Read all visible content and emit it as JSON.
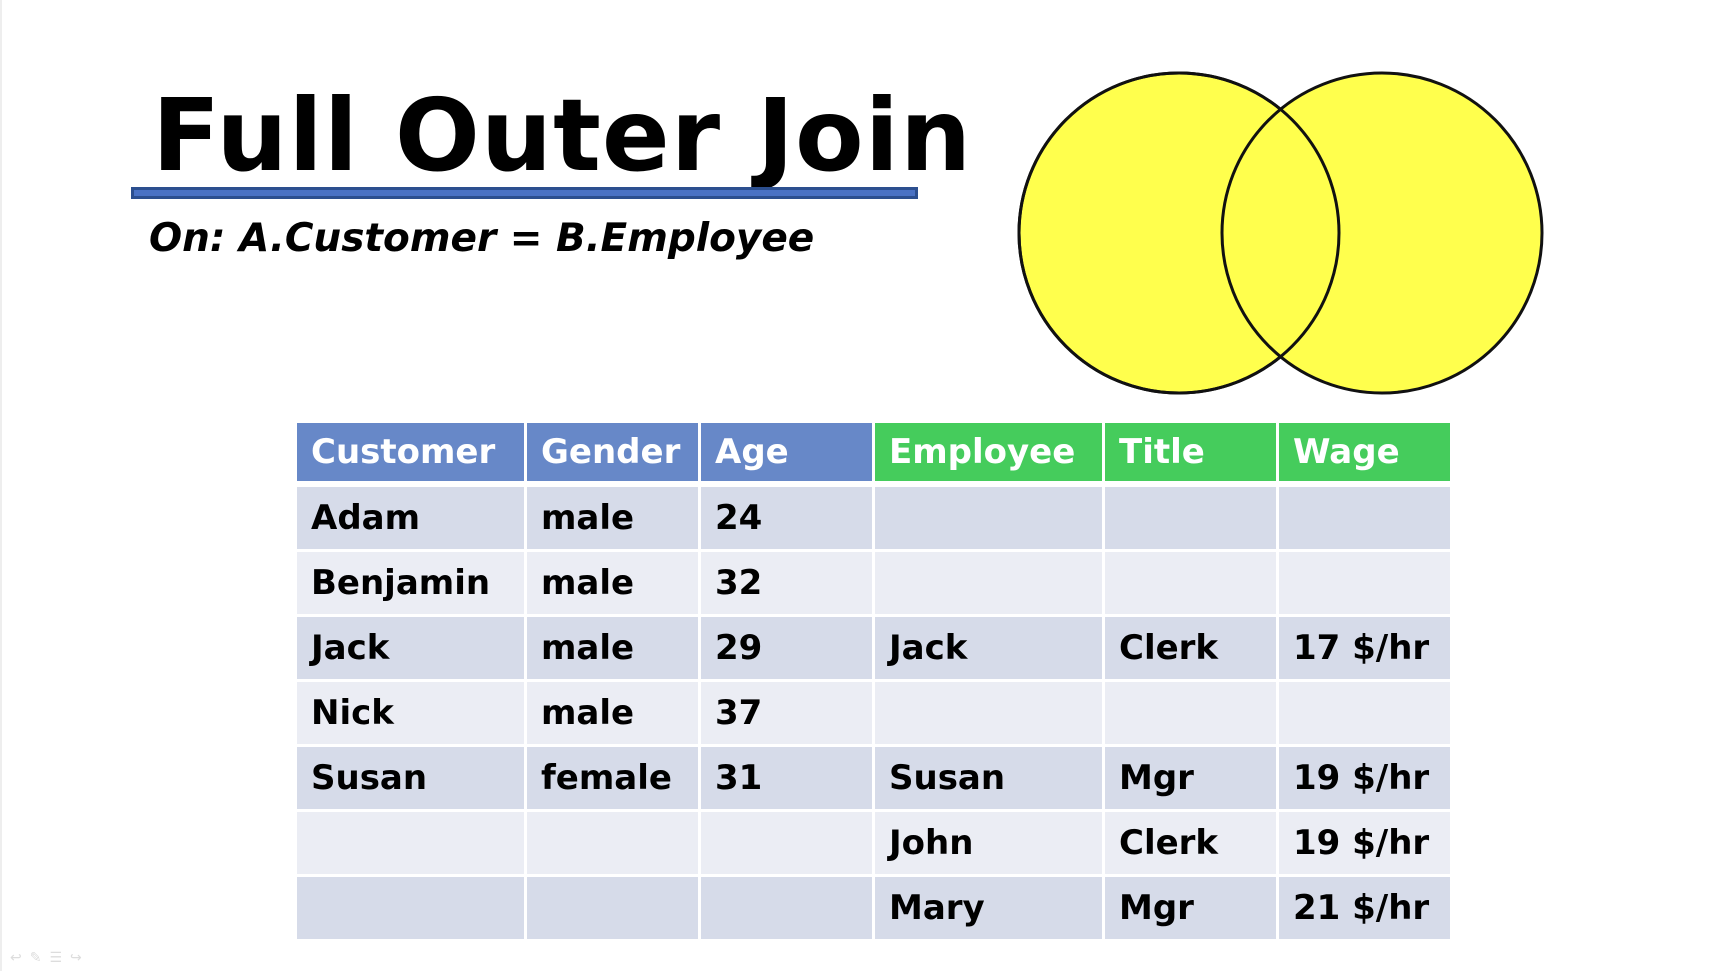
{
  "slide": {
    "title": "Full Outer Join",
    "subtitle": "On: A.Customer = B.Employee"
  },
  "venn": {
    "left_fill": "#ffff4d",
    "right_fill": "#ffff4d",
    "outline": "#111111"
  },
  "table": {
    "left_header_color": "#6788c8",
    "right_header_color": "#45cc5c",
    "headers": [
      "Customer",
      "Gender",
      "Age",
      "Employee",
      "Title",
      "Wage"
    ],
    "rows": [
      [
        "Adam",
        "male",
        "24",
        "",
        "",
        ""
      ],
      [
        "Benjamin",
        "male",
        "32",
        "",
        "",
        ""
      ],
      [
        "Jack",
        "male",
        "29",
        "Jack",
        "Clerk",
        "17 $/hr"
      ],
      [
        "Nick",
        "male",
        "37",
        "",
        "",
        ""
      ],
      [
        "Susan",
        "female",
        "31",
        "Susan",
        "Mgr",
        "19 $/hr"
      ],
      [
        "",
        "",
        "",
        "John",
        "Clerk",
        "19 $/hr"
      ],
      [
        "",
        "",
        "",
        "Mary",
        "Mgr",
        "21 $/hr"
      ]
    ]
  },
  "controls": {
    "icons": [
      "prev-icon",
      "pen-icon",
      "menu-icon",
      "next-icon"
    ]
  }
}
